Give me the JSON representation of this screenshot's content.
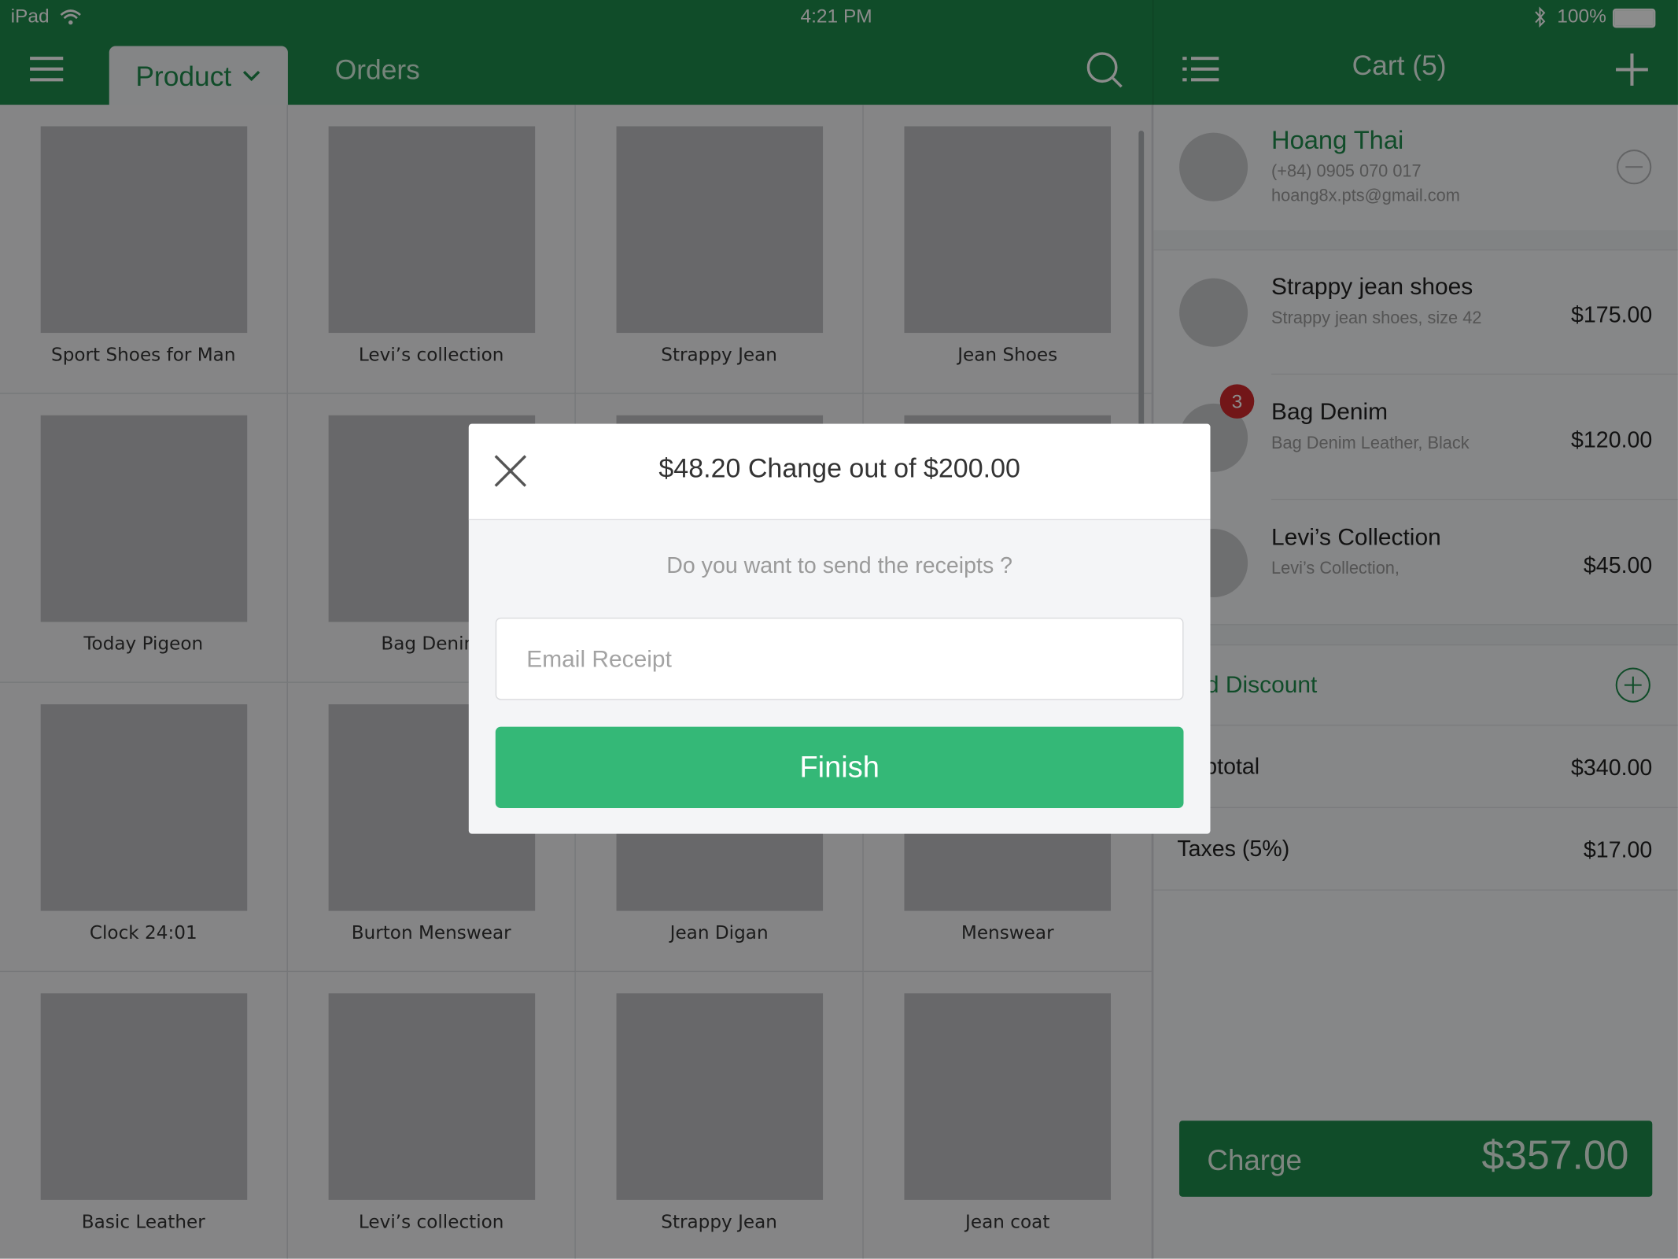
{
  "status_bar": {
    "device": "iPad",
    "time": "4:21 PM",
    "battery": "100%"
  },
  "header": {
    "tab_product": "Product",
    "tab_orders": "Orders",
    "cart_title": "Cart (5)"
  },
  "products": [
    {
      "name": "Sport Shoes for Man"
    },
    {
      "name": "Levi’s collection"
    },
    {
      "name": "Strappy Jean"
    },
    {
      "name": "Jean Shoes"
    },
    {
      "name": "Today Pigeon"
    },
    {
      "name": "Bag Denim"
    },
    {
      "name": ""
    },
    {
      "name": ""
    },
    {
      "name": "Clock 24:01"
    },
    {
      "name": "Burton Menswear"
    },
    {
      "name": "Jean Digan"
    },
    {
      "name": "Menswear"
    },
    {
      "name": "Basic Leather"
    },
    {
      "name": "Levi’s collection"
    },
    {
      "name": "Strappy Jean"
    },
    {
      "name": "Jean coat"
    }
  ],
  "customer": {
    "name": "Hoang Thai",
    "phone": "(+84) 0905 070 017",
    "email": "hoang8x.pts@gmail.com"
  },
  "cart_items": [
    {
      "name": "Strappy jean shoes",
      "detail": "Strappy jean shoes, size 42",
      "price": "$175.00"
    },
    {
      "name": "Bag Denim",
      "detail": "Bag Denim Leather, Black",
      "price": "$120.00",
      "quantity_badge": "3"
    },
    {
      "name": "Levi’s Collection",
      "detail": "Levi’s Collection,",
      "price": "$45.00"
    }
  ],
  "totals": {
    "discount_label": "Add Discount",
    "subtotal_label": "Subtotal",
    "subtotal": "$340.00",
    "taxes_label": "Taxes (5%)",
    "taxes": "$17.00"
  },
  "charge": {
    "label": "Charge",
    "total": "$357.00"
  },
  "modal": {
    "title": "$48.20 Change out of $200.00",
    "question": "Do you want to send the receipts ?",
    "email_placeholder": "Email Receipt",
    "finish_label": "Finish"
  },
  "colors": {
    "brand_green": "#1e8a4c",
    "finish_green": "#34b877",
    "badge_red": "#d0282c"
  }
}
